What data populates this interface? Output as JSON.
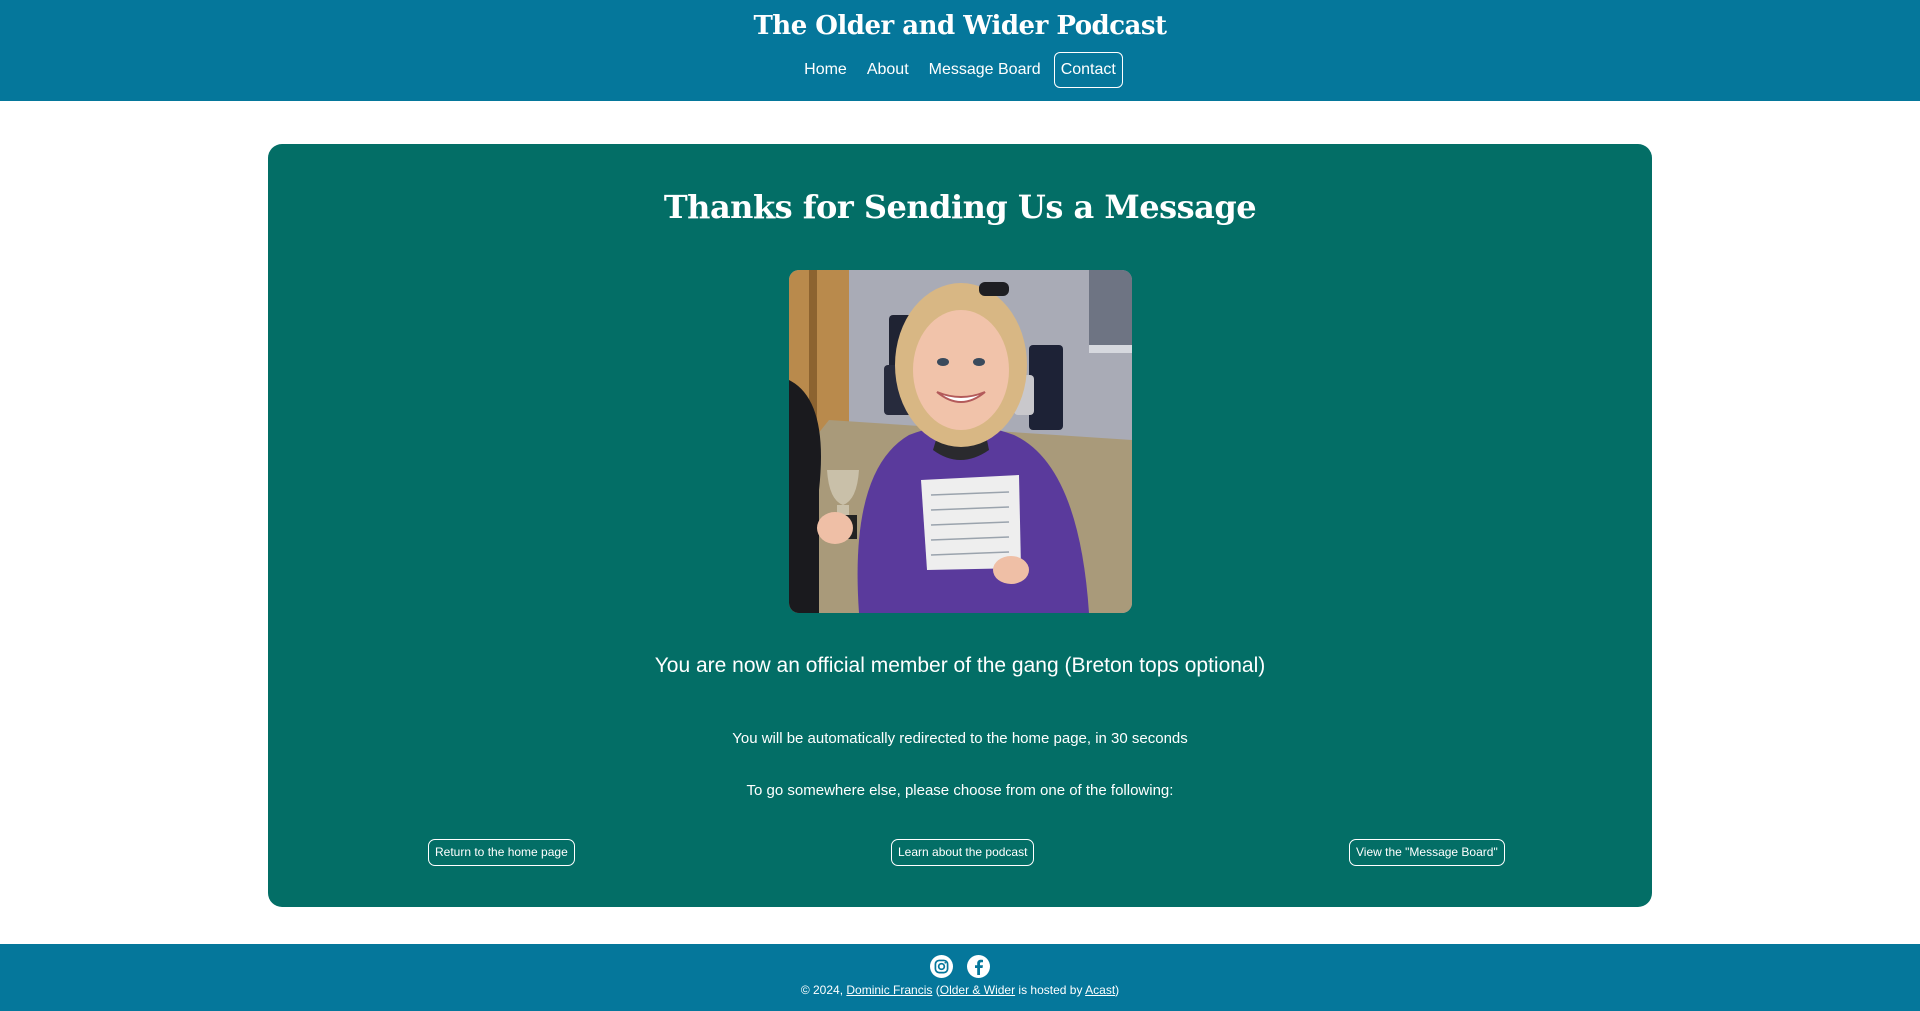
{
  "header": {
    "title": "The Older and Wider Podcast",
    "nav": [
      {
        "label": "Home"
      },
      {
        "label": "About"
      },
      {
        "label": "Message Board"
      },
      {
        "label": "Contact",
        "active": true
      }
    ]
  },
  "card": {
    "heading": "Thanks for Sending Us a Message",
    "tagline": "You are now an official member of the gang (Breton tops optional)",
    "redirect_text": "You will be automatically redirected to the home page, in 30 seconds",
    "choose_text": "To go somewhere else, please choose from one of the following:",
    "buttons": {
      "home": "Return to the home page",
      "about": "Learn about the podcast",
      "board": "View the \"Message Board\""
    }
  },
  "footer": {
    "copyright_prefix": "© 2024, ",
    "author": "Dominic Francis",
    "paren_open": " (",
    "site_link": "Older & Wider",
    "hosted_text": " is hosted by ",
    "host_link": "Acast",
    "paren_close": ")"
  },
  "colors": {
    "header_bg": "#05779b",
    "card_bg": "#036e66"
  }
}
